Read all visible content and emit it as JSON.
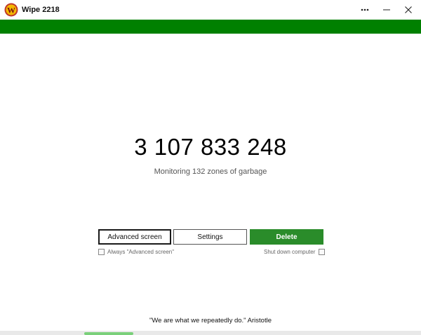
{
  "window": {
    "title": "Wipe 2218",
    "logo_letter": "W"
  },
  "counter": {
    "value": "3 107 833 248",
    "subtitle": "Monitoring 132 zones of garbage"
  },
  "buttons": {
    "advanced_label": "Advanced screen",
    "settings_label": "Settings",
    "delete_label": "Delete"
  },
  "options": {
    "always_advanced_label": "Always \"Advanced screen\"",
    "always_advanced_checked": false,
    "shutdown_label": "Shut down computer",
    "shutdown_checked": false
  },
  "quote": "\"We are what we repeatedly do.\" Aristotle",
  "colors": {
    "accent_green": "#008000",
    "delete_green": "#2a8c2a",
    "logo_red": "#c0392b",
    "logo_yellow": "#f5b800"
  },
  "icons": [
    "app-logo",
    "more-icon",
    "minimize-icon",
    "close-icon"
  ]
}
